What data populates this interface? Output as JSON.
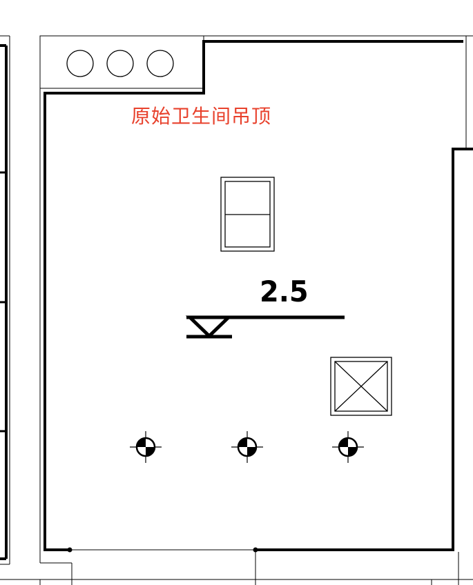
{
  "plan": {
    "title": "原始卫生间吊顶",
    "title_color": "#e8412c",
    "ceiling_elevation": "2.5",
    "line_color": "#000000",
    "fixtures": {
      "pipe_circles": 3,
      "downlights": 3
    },
    "icons": [
      "pipe-circle-icon",
      "vent-fan-icon",
      "exhaust-icon",
      "downlight-icon",
      "elevation-marker-icon"
    ]
  }
}
